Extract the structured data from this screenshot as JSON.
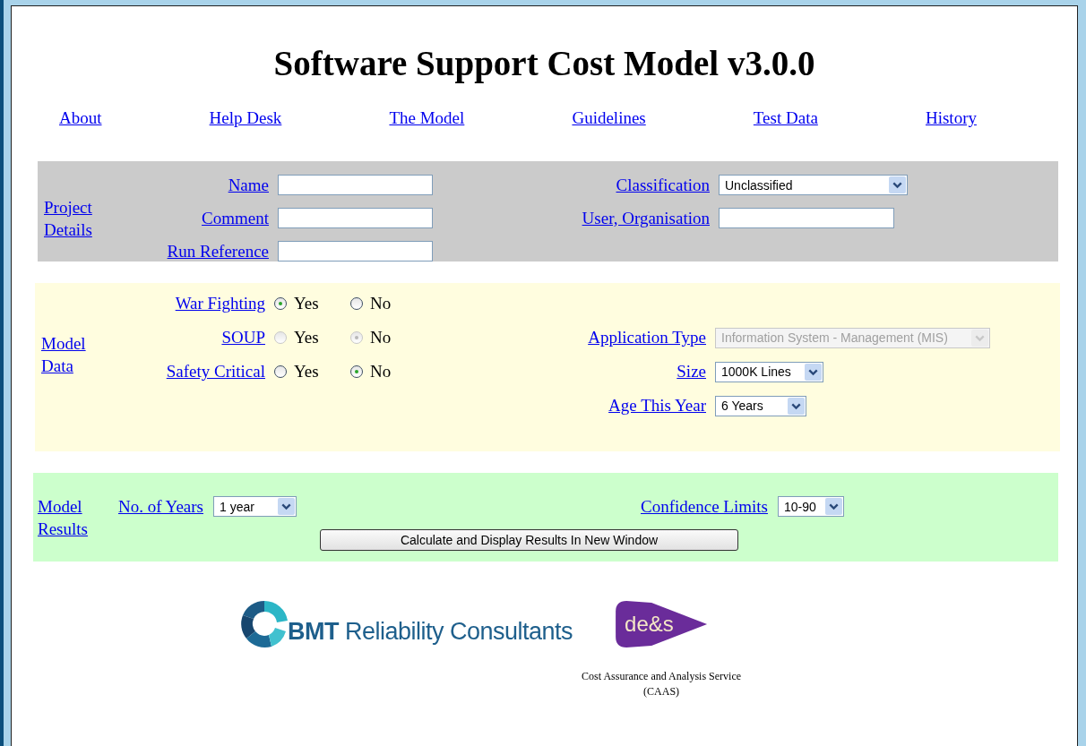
{
  "title": "Software Support Cost Model v3.0.0",
  "nav": [
    "About",
    "Help Desk",
    "The Model",
    "Guidelines",
    "Test Data",
    "History"
  ],
  "project_details": {
    "heading": "Project Details",
    "left_fields": [
      {
        "label": "Name",
        "kind": "text"
      },
      {
        "label": "Comment",
        "kind": "text"
      },
      {
        "label": "Run Reference",
        "kind": "text"
      }
    ],
    "right_fields": [
      {
        "label": "Classification",
        "kind": "select",
        "value": "Unclassified",
        "disabled": false
      },
      {
        "label": "User, Organisation",
        "kind": "text"
      }
    ]
  },
  "model_data": {
    "heading": "Model Data",
    "rows": [
      {
        "left": {
          "label": "War Fighting",
          "disabled": false,
          "options": [
            {
              "label": "Yes",
              "selected": true
            },
            {
              "label": "No",
              "selected": false
            }
          ]
        }
      },
      {
        "left": {
          "label": "SOUP",
          "disabled": true,
          "options": [
            {
              "label": "Yes",
              "selected": false
            },
            {
              "label": "No",
              "selected": true
            }
          ]
        },
        "right": {
          "label": "Application Type",
          "kind": "select",
          "value": "Information System - Management (MIS)",
          "disabled": true
        }
      },
      {
        "left": {
          "label": "Safety Critical",
          "disabled": false,
          "options": [
            {
              "label": "Yes",
              "selected": false
            },
            {
              "label": "No",
              "selected": true
            }
          ]
        },
        "right": {
          "label": "Size",
          "kind": "select",
          "value": "1000K Lines",
          "disabled": false
        }
      },
      {
        "right": {
          "label": "Age This Year",
          "kind": "select",
          "value": "6 Years",
          "disabled": false
        }
      }
    ]
  },
  "model_results": {
    "heading": "Model Results",
    "fields": [
      {
        "label": "No. of Years",
        "kind": "select",
        "value": "1 year",
        "disabled": false
      },
      {
        "label": "Confidence Limits",
        "kind": "select",
        "value": "10-90",
        "disabled": false
      }
    ],
    "button": "Calculate and Display Results In New Window"
  },
  "footer": {
    "bmt_logo": "**BMT** Reliability Consultants",
    "des_logo": "de&s",
    "caption": [
      "Cost Assurance and Analysis Service",
      "(CAAS)"
    ]
  }
}
